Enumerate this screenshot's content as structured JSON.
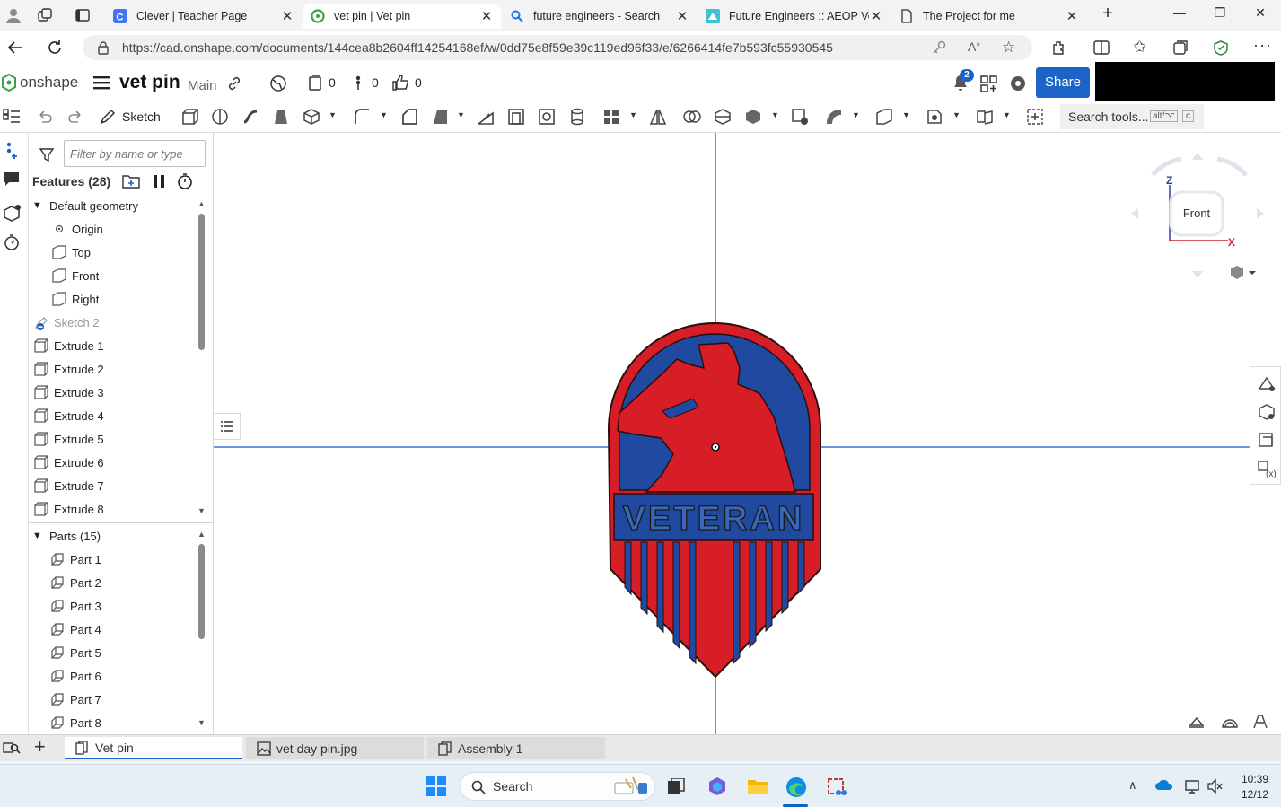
{
  "browser": {
    "tabs": [
      {
        "title": "Clever | Teacher Page",
        "active": false
      },
      {
        "title": "vet pin | Vet pin",
        "active": true
      },
      {
        "title": "future engineers - Search",
        "active": false
      },
      {
        "title": "Future Engineers :: AEOP Vete",
        "active": false
      },
      {
        "title": "The Project for me",
        "active": false
      }
    ],
    "url": "https://cad.onshape.com/documents/144cea8b2604ff14254168ef/w/0dd75e8f59e39c119ed96f33/e/6266414fe7b593fc55930545"
  },
  "onshape": {
    "logo": "onshape",
    "doc_title": "vet pin",
    "branch": "Main",
    "versions_count": "0",
    "branches_count": "0",
    "likes_count": "0",
    "notifications_badge": "2",
    "share_label": "Share",
    "sketch_label": "Sketch",
    "search_tools_placeholder": "Search tools...",
    "search_tools_shortcut_1": "alt/⌥",
    "search_tools_shortcut_2": "c"
  },
  "panel": {
    "filter_placeholder": "Filter by name or type",
    "features_header": "Features (28)",
    "default_geometry_label": "Default geometry",
    "default_geometry": [
      "Origin",
      "Top",
      "Front",
      "Right"
    ],
    "sketch_item": "Sketch 2",
    "extrudes": [
      "Extrude 1",
      "Extrude 2",
      "Extrude 3",
      "Extrude 4",
      "Extrude 5",
      "Extrude 6",
      "Extrude 7",
      "Extrude 8"
    ],
    "parts_header": "Parts (15)",
    "parts": [
      "Part 1",
      "Part 2",
      "Part 3",
      "Part 4",
      "Part 5",
      "Part 6",
      "Part 7",
      "Part 8"
    ]
  },
  "viewport": {
    "view_cube_label": "Front",
    "axis_z": "Z",
    "axis_x": "X",
    "model_text": "VETERAN",
    "colors": {
      "red": "#d71e27",
      "blue": "#1f4aa0",
      "outline": "#2a0d0d",
      "axis_line": "#6f94d9"
    }
  },
  "bottom_tabs": [
    {
      "label": "Vet pin",
      "active": true
    },
    {
      "label": "vet day pin.jpg",
      "active": false
    },
    {
      "label": "Assembly 1",
      "active": false
    }
  ],
  "taskbar": {
    "search_label": "Search",
    "time": "10:39",
    "date": "12/12"
  }
}
